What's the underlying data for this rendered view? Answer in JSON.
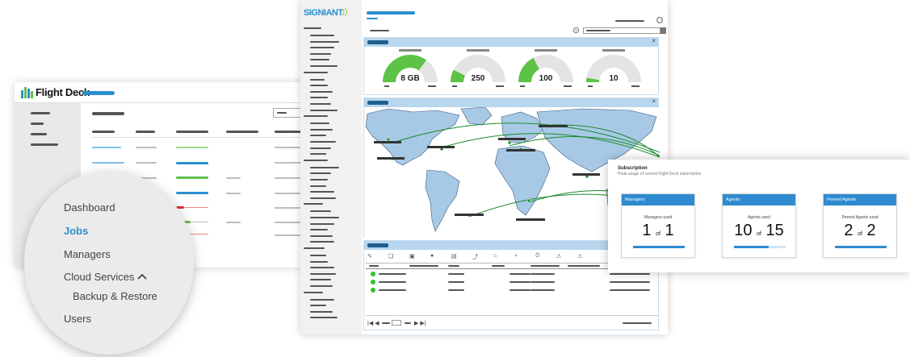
{
  "flight_deck": {
    "logo_text": "Flight Deck",
    "menu": {
      "dashboard": "Dashboard",
      "jobs": "Jobs",
      "managers": "Managers",
      "cloud_services": "Cloud Services",
      "backup_restore": "Backup & Restore",
      "users": "Users"
    }
  },
  "signiant": {
    "logo_text": "SIGNIANT",
    "gauges": [
      {
        "label": "8 GB",
        "fill": 0.7
      },
      {
        "label": "250",
        "fill": 0.15
      },
      {
        "label": "100",
        "fill": 0.35
      },
      {
        "label": "10",
        "fill": 0.05
      }
    ]
  },
  "subscription": {
    "title": "Subscription",
    "subtitle": "Peak usage of current Flight Deck subscription",
    "cards": [
      {
        "title": "Managers",
        "used_label": "Managers used",
        "used": "1",
        "of": "of",
        "total": "1",
        "fraction": 1.0
      },
      {
        "title": "Agents",
        "used_label": "Agents used",
        "used": "10",
        "of": "of",
        "total": "15",
        "fraction": 0.667
      },
      {
        "title": "Peered Agents",
        "used_label": "Peered Agents used",
        "used": "2",
        "of": "of",
        "total": "2",
        "fraction": 1.0
      }
    ]
  },
  "colors": {
    "accent_blue": "#2a8fd0",
    "gauge_green": "#5cc346",
    "map_land": "#a8c9e6"
  }
}
